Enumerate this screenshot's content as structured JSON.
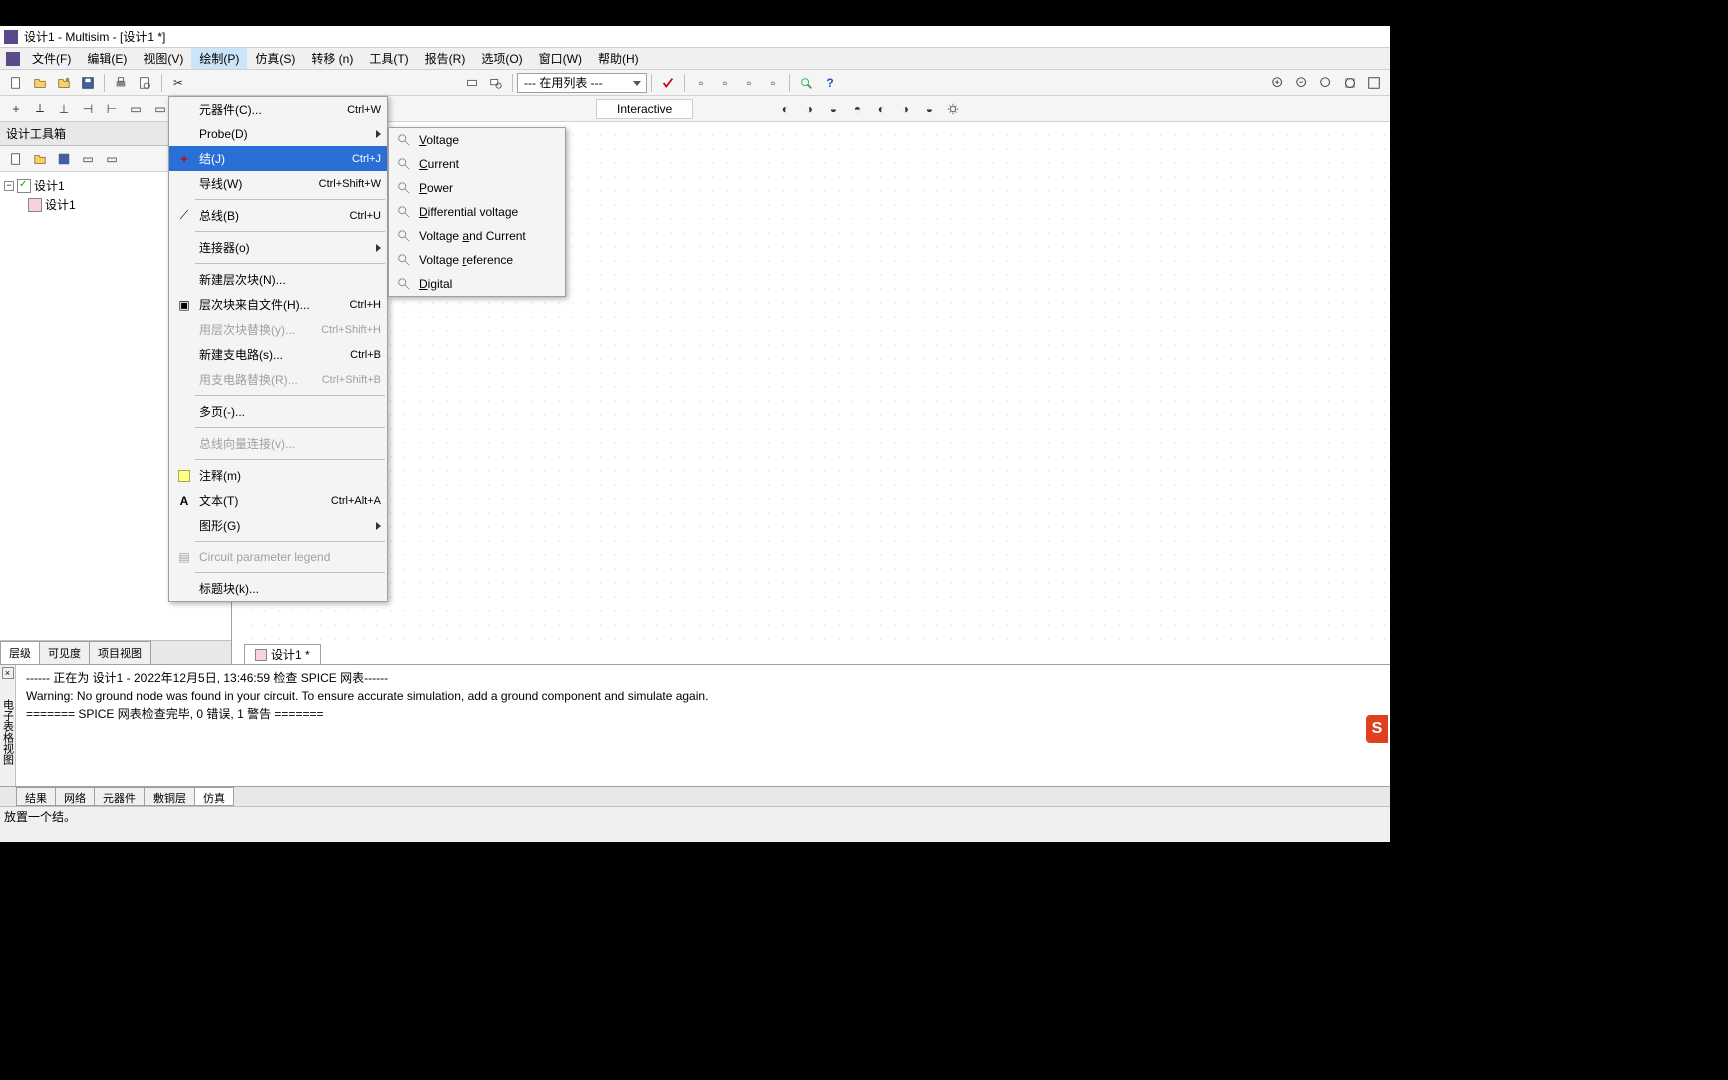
{
  "window": {
    "title": "设计1 - Multisim - [设计1 *]"
  },
  "menubar": {
    "items": [
      "文件(F)",
      "编辑(E)",
      "视图(V)",
      "绘制(P)",
      "仿真(S)",
      "转移 (n)",
      "工具(T)",
      "报告(R)",
      "选项(O)",
      "窗口(W)",
      "帮助(H)"
    ],
    "active_index": 3
  },
  "toolbar": {
    "combo_text": "--- 在用列表 ---"
  },
  "toolbar2": {
    "interactive_label": "Interactive"
  },
  "sidepanel": {
    "title": "设计工具箱",
    "tree": {
      "root": "设计1",
      "child": "设计1"
    },
    "tabs": [
      "层级",
      "可见度",
      "项目视图"
    ],
    "active_tab": 0
  },
  "canvas": {
    "tab": "设计1 *"
  },
  "dropdown": {
    "items": [
      {
        "label": "元器件(C)...",
        "shortcut": "Ctrl+W"
      },
      {
        "label": "Probe(D)",
        "arrow": true,
        "icon": ""
      },
      {
        "label": "结(J)",
        "shortcut": "Ctrl+J",
        "highlight": true,
        "icon": "plus-red"
      },
      {
        "label": "导线(W)",
        "shortcut": "Ctrl+Shift+W"
      },
      {
        "sep": true
      },
      {
        "label": "总线(B)",
        "shortcut": "Ctrl+U",
        "icon": "bus"
      },
      {
        "sep": true
      },
      {
        "label": "连接器(o)",
        "arrow": true
      },
      {
        "sep": true
      },
      {
        "label": "新建层次块(N)..."
      },
      {
        "label": "层次块来自文件(H)...",
        "shortcut": "Ctrl+H",
        "icon": "hb"
      },
      {
        "label": "用层次块替换(y)...",
        "shortcut": "Ctrl+Shift+H",
        "disabled": true
      },
      {
        "label": "新建支电路(s)...",
        "shortcut": "Ctrl+B"
      },
      {
        "label": "用支电路替换(R)...",
        "shortcut": "Ctrl+Shift+B",
        "disabled": true
      },
      {
        "sep": true
      },
      {
        "label": "多页(-)..."
      },
      {
        "sep": true
      },
      {
        "label": "总线向量连接(v)...",
        "disabled": true
      },
      {
        "sep": true
      },
      {
        "label": "注释(m)",
        "icon": "note"
      },
      {
        "label": "文本(T)",
        "shortcut": "Ctrl+Alt+A",
        "icon": "text-A"
      },
      {
        "label": "图形(G)",
        "arrow": true
      },
      {
        "sep": true
      },
      {
        "label": "Circuit parameter legend",
        "disabled": true,
        "icon": "legend"
      },
      {
        "sep": true
      },
      {
        "label": "标题块(k)..."
      }
    ]
  },
  "submenu": {
    "items": [
      {
        "label": "Voltage",
        "underline": 0
      },
      {
        "label": "Current",
        "underline": 0
      },
      {
        "label": "Power",
        "underline": 0
      },
      {
        "label": "Differential voltage",
        "underline": 0
      },
      {
        "label": "Voltage and Current",
        "underline": 8
      },
      {
        "label": "Voltage reference",
        "underline": 8
      },
      {
        "label": "Digital",
        "underline": 0
      }
    ]
  },
  "output": {
    "vert_label": "电子表格视图",
    "lines": [
      "------ 正在为 设计1 - 2022年12月5日, 13:46:59 检查 SPICE 网表------",
      "Warning: No ground node was found in your circuit. To ensure accurate simulation, add a ground component and simulate again.",
      "======= SPICE 网表检查完毕, 0 错误, 1 警告 ======="
    ],
    "tabs": [
      "结果",
      "网络",
      "元器件",
      "敷铜层",
      "仿真"
    ],
    "active_tab": 4
  },
  "statusbar": {
    "text": "放置一个结。"
  }
}
